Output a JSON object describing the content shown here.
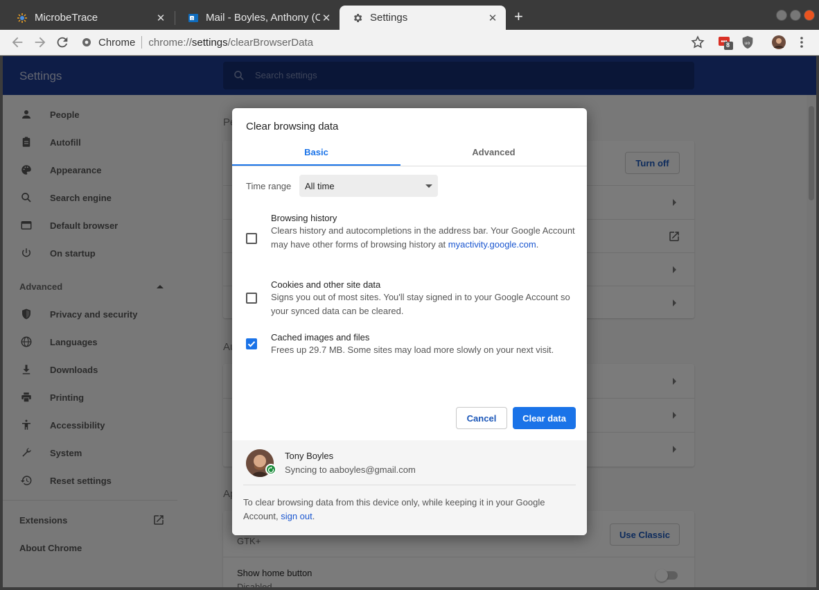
{
  "browser": {
    "tabs": [
      {
        "title": "MicrobeTrace",
        "icon": "microbetrace-icon"
      },
      {
        "title": "Mail - Boyles, Anthony (CDC",
        "icon": "outlook-icon"
      },
      {
        "title": "Settings",
        "icon": "gear-icon"
      }
    ],
    "close_glyph": "✕",
    "new_tab_glyph": "+",
    "omnibox": {
      "site_label": "Chrome",
      "scheme": "chrome://",
      "host": "settings",
      "path": "/clearBrowserData"
    },
    "extension_badge": "8"
  },
  "settings": {
    "title": "Settings",
    "search_placeholder": "Search settings",
    "nav": {
      "items": [
        {
          "label": "People",
          "icon": "person-icon"
        },
        {
          "label": "Autofill",
          "icon": "clipboard-icon"
        },
        {
          "label": "Appearance",
          "icon": "palette-icon"
        },
        {
          "label": "Search engine",
          "icon": "search-icon"
        },
        {
          "label": "Default browser",
          "icon": "browser-window-icon"
        },
        {
          "label": "On startup",
          "icon": "power-icon"
        }
      ],
      "advanced_label": "Advanced",
      "advanced_items": [
        {
          "label": "Privacy and security",
          "icon": "shield-icon"
        },
        {
          "label": "Languages",
          "icon": "globe-icon"
        },
        {
          "label": "Downloads",
          "icon": "download-icon"
        },
        {
          "label": "Printing",
          "icon": "printer-icon"
        },
        {
          "label": "Accessibility",
          "icon": "accessibility-icon"
        },
        {
          "label": "System",
          "icon": "wrench-icon"
        },
        {
          "label": "Reset settings",
          "icon": "history-icon"
        }
      ],
      "extensions_label": "Extensions",
      "about_label": "About Chrome"
    },
    "background": {
      "section_letters": [
        "Pe",
        "Au",
        "Ap"
      ],
      "turn_off_label": "Turn off",
      "use_classic_label": "Use Classic",
      "gtk_label": "GTK+",
      "home_button_label": "Show home button",
      "home_button_state": "Disabled"
    }
  },
  "dialog": {
    "title": "Clear browsing data",
    "tabs": [
      "Basic",
      "Advanced"
    ],
    "active_tab": "Basic",
    "time_range_label": "Time range",
    "time_range_value": "All time",
    "options": [
      {
        "title": "Browsing history",
        "desc": "Clears history and autocompletions in the address bar. Your Google Account may have other forms of browsing history at",
        "link": "myactivity.google.com",
        "link_suffix": ".",
        "checked": false
      },
      {
        "title": "Cookies and other site data",
        "desc": "Signs you out of most sites. You'll stay signed in to your Google Account so your synced data can be cleared.",
        "checked": false
      },
      {
        "title": "Cached images and files",
        "desc": "Frees up 29.7 MB. Some sites may load more slowly on your next visit.",
        "checked": true
      }
    ],
    "cancel_label": "Cancel",
    "confirm_label": "Clear data",
    "account": {
      "name": "Tony Boyles",
      "sync_status": "Syncing to aaboyles@gmail.com"
    },
    "footer_note": "To clear browsing data from this device only, while keeping it in your Google Account,",
    "footer_link": "sign out",
    "footer_suffix": "."
  },
  "colors": {
    "header": "#1c3a8f",
    "accent": "#1a73e8",
    "link": "#1a56d0",
    "sync_badge": "#1e8e3e"
  }
}
